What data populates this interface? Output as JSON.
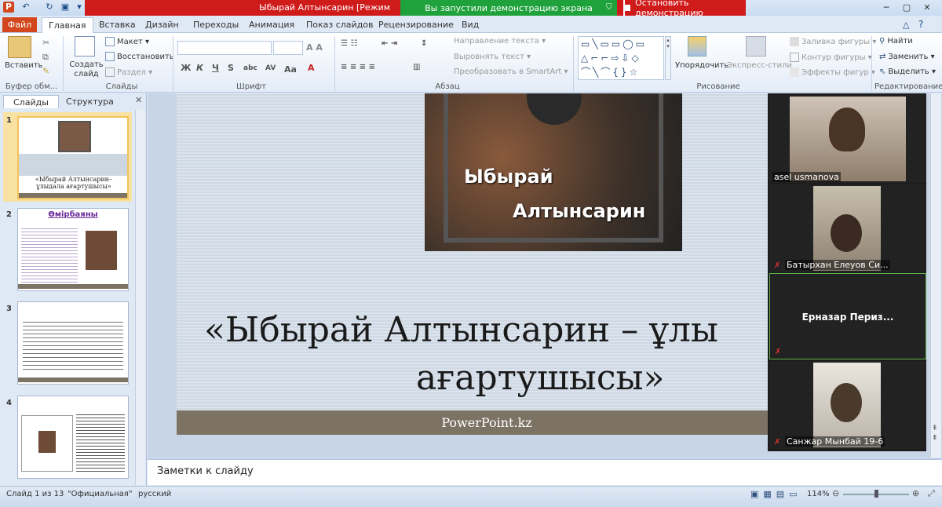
{
  "titlebar": {
    "title": "Ыбырай Алтынсарин [Режим",
    "share_status": "Вы запустили демонстрацию экрана",
    "stop_share": "Остановить демонстрацию"
  },
  "tabs": [
    "Файл",
    "Главная",
    "Вставка",
    "Дизайн",
    "Переходы",
    "Анимация",
    "Показ слайдов",
    "Рецензирование",
    "Вид"
  ],
  "ribbon": {
    "paste": "Вставить",
    "clipboard_label": "Буфер обм...",
    "new_slide": "Создать слайд",
    "layout": "Макет",
    "reset": "Восстановить",
    "section": "Раздел",
    "slides_label": "Слайды",
    "font_label": "Шрифт",
    "text_direction": "Направление текста",
    "align_text": "Выровнять текст",
    "smartart": "Преобразовать в SmartArt",
    "paragraph_label": "Абзац",
    "arrange": "Упорядочить",
    "quick_styles": "Экспресс-стили",
    "shape_fill": "Заливка фигуры",
    "shape_outline": "Контур фигуры",
    "shape_effects": "Эффекты фигур",
    "drawing_label": "Рисование",
    "find": "Найти",
    "replace": "Заменить",
    "select": "Выделить",
    "editing_label": "Редактирование"
  },
  "left_pane": {
    "tab_slides": "Слайды",
    "tab_outline": "Структура",
    "thumbs": [
      {
        "num": "1",
        "caption": "«Ыбырай Алтынсарин– ұлыдала ағартушысы»"
      },
      {
        "num": "2",
        "caption": "Өмірбаяны"
      },
      {
        "num": "3",
        "caption": ""
      },
      {
        "num": "4",
        "caption": ""
      }
    ]
  },
  "slide": {
    "portrait_line1": "Ыбырай",
    "portrait_line2": "Алтынсарин",
    "title_line1": "«Ыбырай Алтынсарин – ұлы",
    "title_line2": "ағартушысы»",
    "footer": "PowerPoint.kz"
  },
  "notes": {
    "placeholder": "Заметки к слайду"
  },
  "status": {
    "slide_count": "Слайд 1 из 13",
    "theme": "\"Официальная\"",
    "language": "русский",
    "zoom": "114%"
  },
  "participants": [
    {
      "name": "asel usmanova",
      "video": true,
      "muted": false
    },
    {
      "name": "Батырхан Елеуов Си...",
      "video": true,
      "muted": true
    },
    {
      "name": "Ерназар  Периз...",
      "video": false,
      "muted": true
    },
    {
      "name": "Санжар Мынбай 19-6",
      "video": true,
      "muted": true
    }
  ],
  "colors": {
    "share_green": "#1fa23c",
    "share_red": "#d01b1b",
    "file_tab": "#d2471d",
    "slide_footer": "#7d7365"
  }
}
